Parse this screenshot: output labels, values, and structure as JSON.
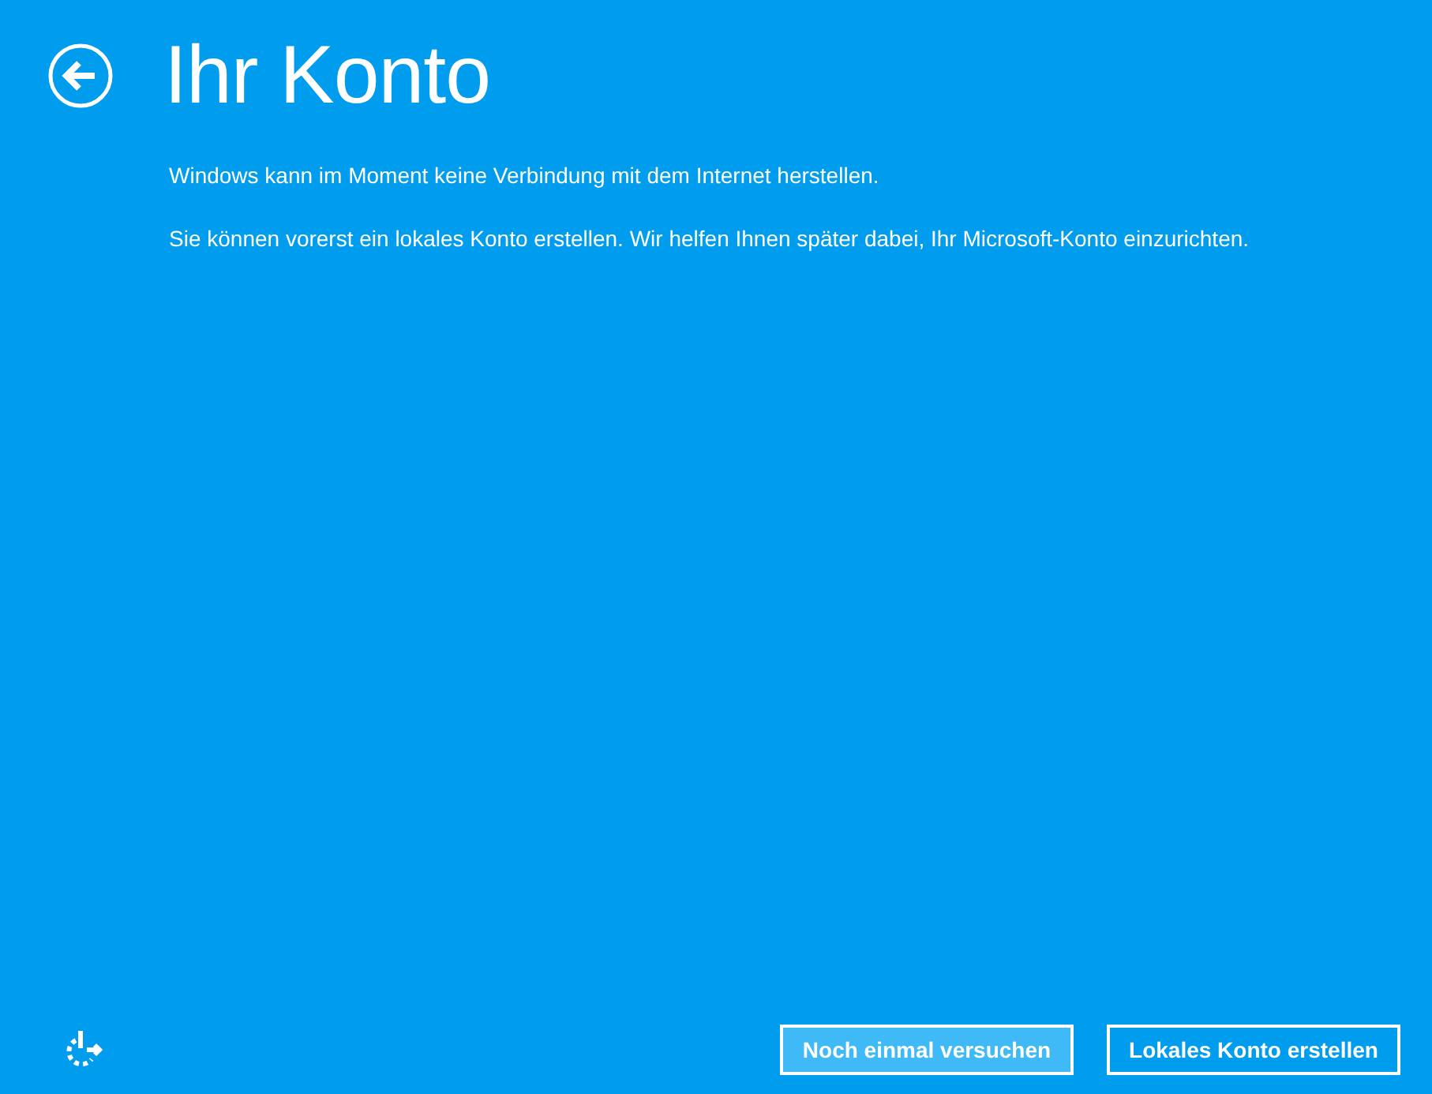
{
  "title": "Ihr Konto",
  "paragraphs": [
    "Windows kann im Moment keine Verbindung mit dem Internet herstellen.",
    "Sie können vorerst ein lokales Konto erstellen. Wir helfen Ihnen später dabei, Ihr Microsoft-Konto einzurichten."
  ],
  "buttons": [
    {
      "label": "Noch einmal versuchen",
      "focused": true
    },
    {
      "label": "Lokales Konto erstellen",
      "focused": false
    }
  ]
}
